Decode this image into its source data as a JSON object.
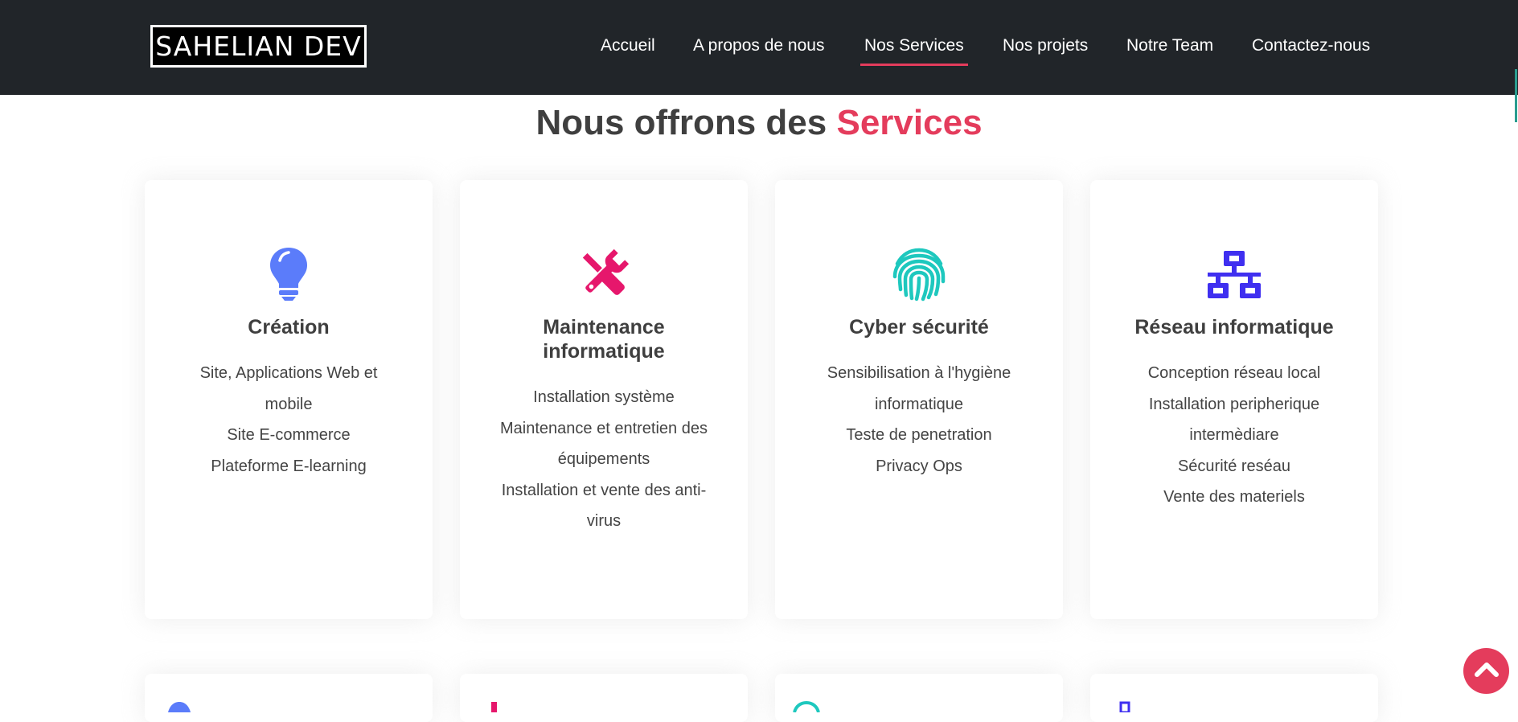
{
  "header": {
    "logo_text": "SAHELIAN DEV",
    "nav": [
      {
        "label": "Accueil"
      },
      {
        "label": "A propos de nous"
      },
      {
        "label": "Nos Services",
        "active": true
      },
      {
        "label": "Nos projets"
      },
      {
        "label": "Notre Team"
      },
      {
        "label": "Contactez-nous"
      }
    ]
  },
  "section": {
    "title_prefix": "Nous offrons des",
    "title_accent": "Services"
  },
  "cards": [
    {
      "icon": "lightbulb-icon",
      "icon_color": "#5b7cfa",
      "title": "Création",
      "items": [
        "Site, Applications Web et",
        "mobile",
        "Site E-commerce",
        "Plateforme E-learning"
      ]
    },
    {
      "icon": "tools-icon",
      "icon_color": "#e6176c",
      "title_line1": "Maintenance",
      "title_line2": "informatique",
      "items": [
        "Installation système",
        "Maintenance et entretien des",
        "équipements",
        "Installation et vente des anti-",
        "virus"
      ]
    },
    {
      "icon": "fingerprint-icon",
      "icon_color": "#1ec8be",
      "title": "Cyber sécurité",
      "items": [
        "Sensibilisation à l'hygiène",
        "informatique",
        "Teste de penetration",
        "Privacy Ops"
      ]
    },
    {
      "icon": "network-icon",
      "icon_color": "#3f2ff0",
      "title": "Réseau informatique",
      "items": [
        "Conception réseau local",
        "Installation peripherique",
        "intermèdiare",
        "Sécurité reséau",
        "Vente des materiels"
      ]
    }
  ],
  "colors": {
    "header_bg": "#212529",
    "accent": "#e43c5c"
  }
}
